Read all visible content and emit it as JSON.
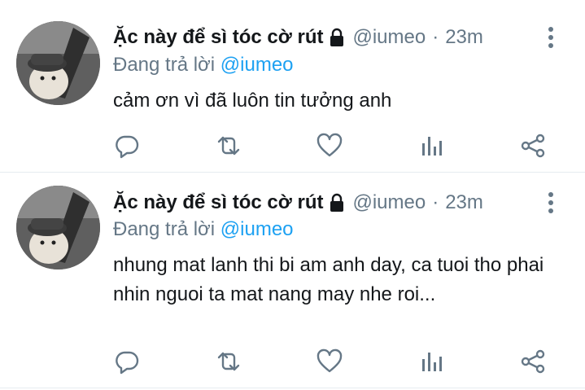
{
  "tweets": [
    {
      "author_name": "Ặc này để sì tóc cờ rút",
      "handle": "@iumeo",
      "separator": "·",
      "time": "23m",
      "replying_prefix": "Đang trả lời",
      "replying_to": "@iumeo",
      "text": "cảm ơn vì đã luôn tin tưởng anh",
      "icons": [
        "reply-icon",
        "retweet-icon",
        "like-icon",
        "analytics-icon",
        "share-icon"
      ]
    },
    {
      "author_name": "Ặc này để sì tóc cờ rút",
      "handle": "@iumeo",
      "separator": "·",
      "time": "23m",
      "replying_prefix": "Đang trả lời",
      "replying_to": "@iumeo",
      "text": "nhung mat lanh thi bi am anh day, ca tuoi tho phai nhin nguoi ta mat nang may nhe roi...",
      "icons": [
        "reply-icon",
        "retweet-icon",
        "like-icon",
        "analytics-icon",
        "share-icon"
      ]
    }
  ],
  "colors": {
    "text": "#14171a",
    "secondary": "#657786",
    "link": "#1da1f2",
    "divider": "#e6ecf0"
  }
}
